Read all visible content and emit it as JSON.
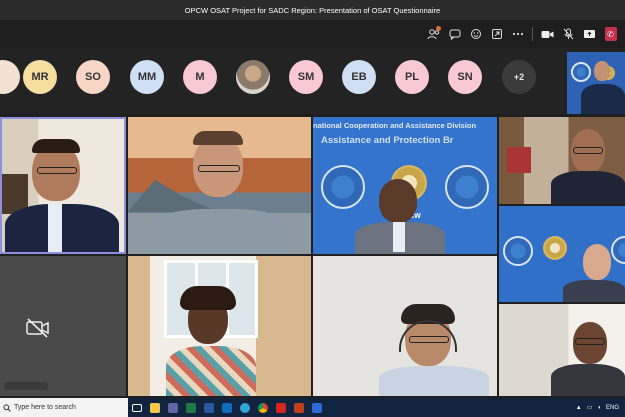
{
  "window": {
    "title": "OPCW OSAT Project for SADC Region: Presentation of OSAT Questionnaire"
  },
  "toolbar": {
    "icons": [
      "people-icon",
      "chat-icon",
      "reactions-icon",
      "share-tray-icon",
      "more-icon",
      "camera-icon",
      "mic-icon",
      "share-icon",
      "leave-icon"
    ]
  },
  "participants": [
    {
      "initials": "MR",
      "color": "#f5dfa0"
    },
    {
      "initials": "SO",
      "color": "#f7d6c5"
    },
    {
      "initials": "MM",
      "color": "#cfe0f5"
    },
    {
      "initials": "M",
      "color": "#f8c9d2"
    },
    {
      "initials": "",
      "color": "",
      "photo": true
    },
    {
      "initials": "SM",
      "color": "#f8c9d2"
    },
    {
      "initials": "EB",
      "color": "#cfe0f5"
    },
    {
      "initials": "PL",
      "color": "#f8c9d2"
    },
    {
      "initials": "SN",
      "color": "#f8c9d2"
    }
  ],
  "overflow": {
    "label": "+2"
  },
  "tiles": {
    "banner_line1": "national Cooperation and Assistance Division",
    "banner_line2": "Assistance and Protection Br",
    "logo_text": "OPCW",
    "camera_off_icon": "camera-off-icon"
  },
  "taskbar": {
    "search_placeholder": "Type here to search",
    "language": "ENG",
    "accent": "#10233f"
  }
}
